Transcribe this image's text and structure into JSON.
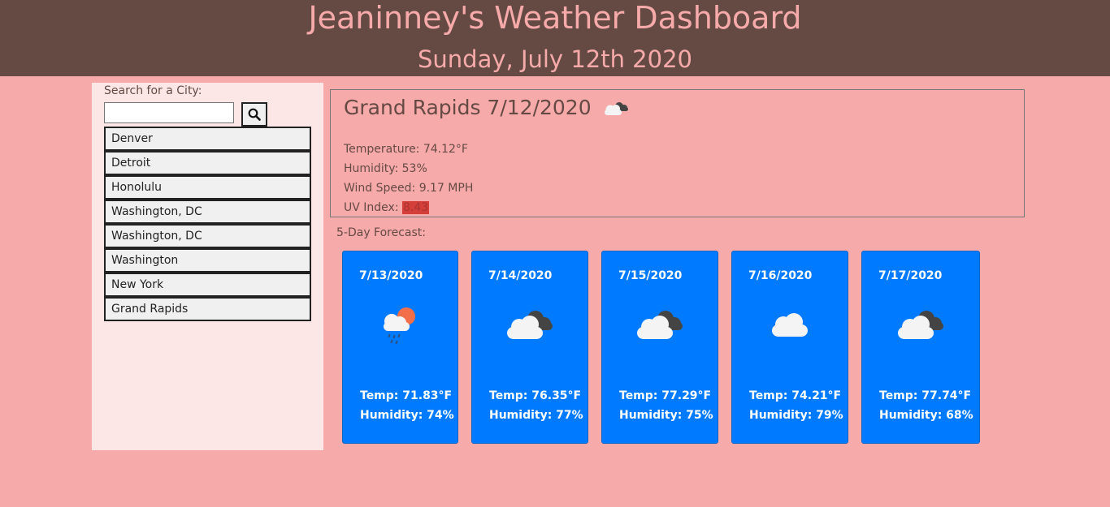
{
  "header": {
    "title": "Jeaninney's Weather Dashboard",
    "date": "Sunday, July 12th 2020"
  },
  "sidebar": {
    "search_label": "Search for a City:",
    "search_value": "",
    "search_icon": "search-icon",
    "cities": [
      "Denver",
      "Detroit",
      "Honolulu",
      "Washington, DC",
      "Washington, DC",
      "Washington",
      "New York",
      "Grand Rapids"
    ]
  },
  "current": {
    "title": "Grand Rapids 7/12/2020",
    "icon": "broken-clouds-icon",
    "temperature": "Temperature: 74.12°F",
    "humidity": "Humidity: 53%",
    "wind": "Wind Speed: 9.17 MPH",
    "uv_label": "UV Index: ",
    "uv_value": "8.43"
  },
  "forecast": {
    "label": "5-Day Forecast:",
    "days": [
      {
        "date": "7/13/2020",
        "icon": "rain-sun-icon",
        "temp": "Temp: 71.83°F",
        "humidity": "Humidity: 74%"
      },
      {
        "date": "7/14/2020",
        "icon": "broken-clouds-icon",
        "temp": "Temp: 76.35°F",
        "humidity": "Humidity: 77%"
      },
      {
        "date": "7/15/2020",
        "icon": "broken-clouds-icon",
        "temp": "Temp: 77.29°F",
        "humidity": "Humidity: 75%"
      },
      {
        "date": "7/16/2020",
        "icon": "cloud-icon",
        "temp": "Temp: 74.21°F",
        "humidity": "Humidity: 79%"
      },
      {
        "date": "7/17/2020",
        "icon": "broken-clouds-icon",
        "temp": "Temp: 77.74°F",
        "humidity": "Humidity: 68%"
      }
    ]
  },
  "colors": {
    "background": "#f7aaaa",
    "header": "#654a44",
    "sidebar": "#fde6e6",
    "card": "#007bff",
    "uv_badge": "#d43f3a"
  }
}
